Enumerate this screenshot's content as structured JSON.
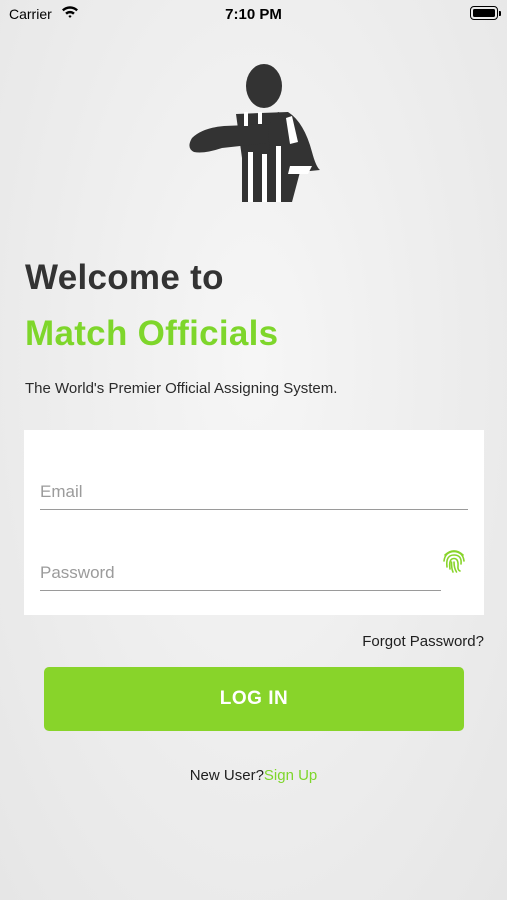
{
  "status_bar": {
    "carrier": "Carrier",
    "time": "7:10 PM",
    "wifi_icon": "wifi-icon",
    "battery_icon": "battery-icon"
  },
  "logo": {
    "icon": "referee-icon",
    "color": "#333333"
  },
  "heading": {
    "welcome": "Welcome to",
    "brand": "Match Officials",
    "tagline": "The World's Premier Official Assigning System."
  },
  "form": {
    "email_placeholder": "Email",
    "email_value": "",
    "password_placeholder": "Password",
    "password_value": "",
    "fingerprint_icon": "fingerprint-icon",
    "forgot_password": "Forgot Password?",
    "login_label": "LOG IN"
  },
  "signup": {
    "prompt": "New User?",
    "link": "Sign Up"
  },
  "colors": {
    "accent": "#88d42a",
    "brand_text": "#7ed62b",
    "dark_text": "#333333",
    "card_bg": "#ffffff"
  }
}
